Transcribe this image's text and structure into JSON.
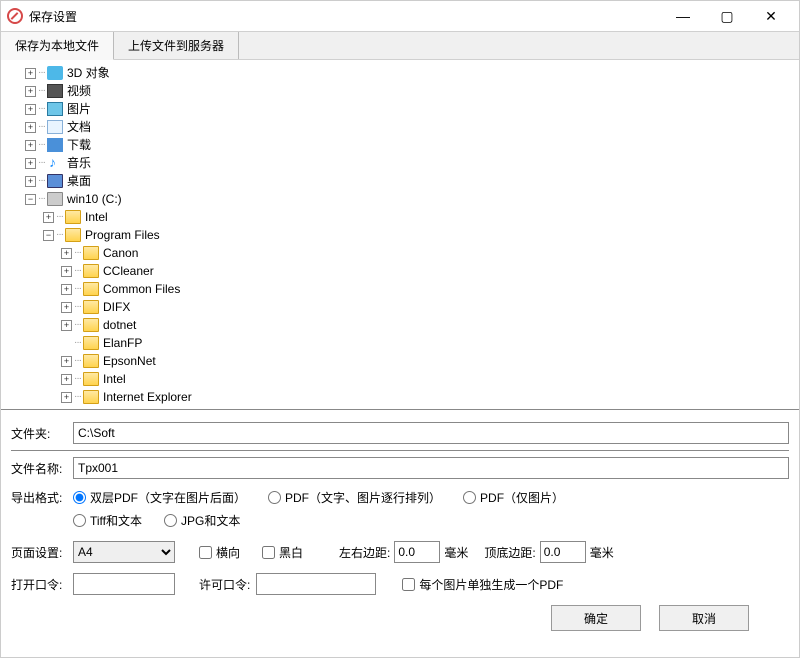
{
  "window": {
    "title": "保存设置"
  },
  "tabs": {
    "local": "保存为本地文件",
    "upload": "上传文件到服务器"
  },
  "tree": {
    "top": [
      {
        "label": "3D 对象",
        "icon": "fi-3d"
      },
      {
        "label": "视频",
        "icon": "fi-video"
      },
      {
        "label": "图片",
        "icon": "fi-pic"
      },
      {
        "label": "文档",
        "icon": "fi-doc"
      },
      {
        "label": "下载",
        "icon": "fi-dl"
      },
      {
        "label": "音乐",
        "icon": "fi-music"
      },
      {
        "label": "桌面",
        "icon": "fi-desktop"
      }
    ],
    "drive": {
      "label": "win10 (C:)"
    },
    "drive_children": [
      "Intel",
      "Program Files"
    ],
    "pf_children": [
      "Canon",
      "CCleaner",
      "Common Files",
      "DIFX",
      "dotnet",
      "ElanFP",
      "EpsonNet",
      "Intel",
      "Internet Explorer"
    ]
  },
  "form": {
    "folder_label": "文件夹:",
    "folder_value": "C:\\Soft",
    "name_label": "文件名称:",
    "name_value": "Tpx001",
    "format_label": "导出格式:",
    "formats": {
      "f1": "双层PDF（文字在图片后面）",
      "f2": "PDF（文字、图片逐行排列）",
      "f3": "PDF（仅图片）",
      "f4": "Tiff和文本",
      "f5": "JPG和文本"
    },
    "page_label": "页面设置:",
    "page_value": "A4",
    "landscape": "横向",
    "bw": "黑白",
    "lrmargin_label": "左右边距:",
    "lrmargin_value": "0.0",
    "mm": "毫米",
    "tbmargin_label": "顶底边距:",
    "tbmargin_value": "0.0",
    "openpwd_label": "打开口令:",
    "permpwd_label": "许可口令:",
    "eachpdf": "每个图片单独生成一个PDF",
    "ok": "确定",
    "cancel": "取消"
  }
}
